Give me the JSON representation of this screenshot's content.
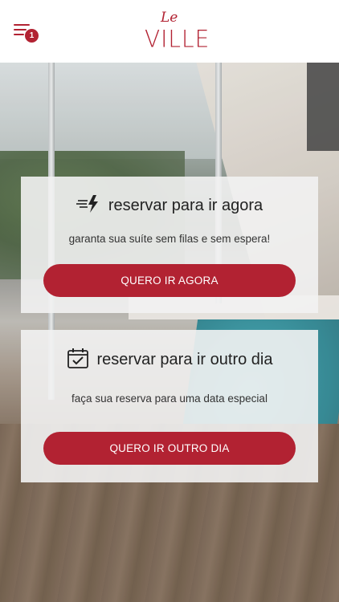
{
  "header": {
    "menu_badge": "1",
    "logo_small": "Le",
    "logo_main": "VILLE"
  },
  "cards": [
    {
      "title": "reservar para ir agora",
      "subtitle": "garanta sua suíte sem filas e sem espera!",
      "button_label": "QUERO IR AGORA",
      "icon": "fast-lightning-icon"
    },
    {
      "title": "reservar para ir outro dia",
      "subtitle": "faça sua reserva para uma data especial",
      "button_label": "QUERO IR OUTRO DIA",
      "icon": "calendar-check-icon"
    }
  ],
  "colors": {
    "brand": "#b22232",
    "card_background": "#f2f2f2",
    "title_text": "#222222"
  }
}
